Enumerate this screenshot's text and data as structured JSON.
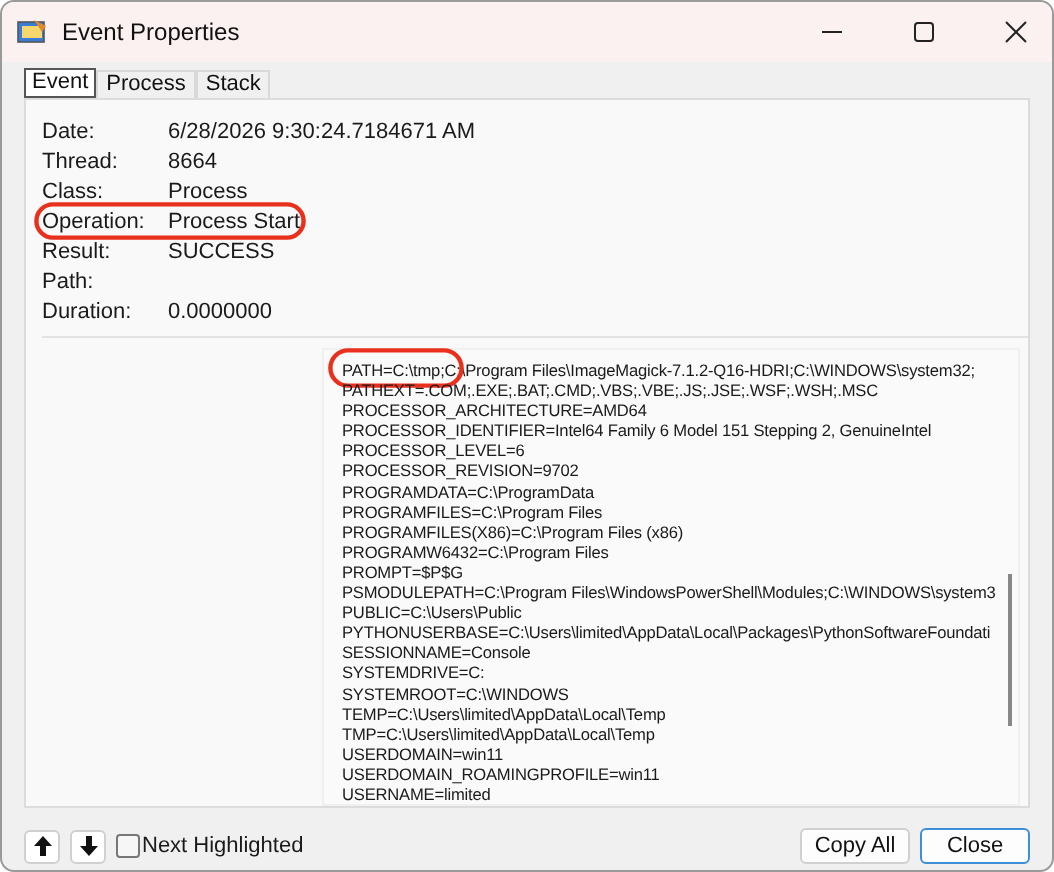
{
  "window": {
    "title": "Event Properties"
  },
  "tabs": [
    {
      "label": "Event",
      "selected": true
    },
    {
      "label": "Process",
      "selected": false
    },
    {
      "label": "Stack",
      "selected": false
    }
  ],
  "fields": [
    {
      "label": "Date:",
      "value": "6/28/2026 9:30:24.7184671 AM",
      "highlighted": false
    },
    {
      "label": "Thread:",
      "value": "8664",
      "highlighted": false
    },
    {
      "label": "Class:",
      "value": "Process",
      "highlighted": false
    },
    {
      "label": "Operation:",
      "value": "Process Start",
      "highlighted": true
    },
    {
      "label": "Result:",
      "value": "SUCCESS",
      "highlighted": false
    },
    {
      "label": "Path:",
      "highlighted": false
    },
    {
      "label": "Duration:",
      "value": "0.0000000",
      "highlighted": false
    }
  ],
  "details": {
    "lines": [
      {
        "text": "PATH=C:\\tmp;C:\\Program Files\\ImageMagick-7.1.2-Q16-HDRI;C:\\WINDOWS\\system32;",
        "highlighted": true
      },
      {
        "text": "PATHEXT=.COM;.EXE;.BAT;.CMD;.VBS;.VBE;.JS;.JSE;.WSF;.WSH;.MSC",
        "highlighted": false
      },
      {
        "text": "PROCESSOR_ARCHITECTURE=AMD64",
        "highlighted": false
      },
      {
        "text": "PROCESSOR_IDENTIFIER=Intel64 Family 6 Model 151 Stepping 2, GenuineIntel",
        "highlighted": false
      },
      {
        "text": "PROCESSOR_LEVEL=6",
        "highlighted": false
      },
      {
        "text": "PROCESSOR_REVISION=9702",
        "highlighted": false
      },
      {
        "text": "PROGRAMDATA=C:\\ProgramData",
        "highlighted": false
      },
      {
        "text": "PROGRAMFILES=C:\\Program Files",
        "highlighted": false
      },
      {
        "text": "PROGRAMFILES(X86)=C:\\Program Files (x86)",
        "highlighted": false
      },
      {
        "text": "PROGRAMW6432=C:\\Program Files",
        "highlighted": false
      },
      {
        "text": "PROMPT=$P$G",
        "highlighted": false
      },
      {
        "text": "PSMODULEPATH=C:\\Program Files\\WindowsPowerShell\\Modules;C:\\WINDOWS\\system3",
        "highlighted": false
      },
      {
        "text": "PUBLIC=C:\\Users\\Public",
        "highlighted": false
      },
      {
        "text": "PYTHONUSERBASE=C:\\Users\\limited\\AppData\\Local\\Packages\\PythonSoftwareFoundati",
        "highlighted": false
      },
      {
        "text": "SESSIONNAME=Console",
        "highlighted": false
      },
      {
        "text": "SYSTEMDRIVE=C:",
        "highlighted": false
      },
      {
        "text": "SYSTEMROOT=C:\\WINDOWS",
        "highlighted": false
      },
      {
        "text": "TEMP=C:\\Users\\limited\\AppData\\Local\\Temp",
        "highlighted": false
      },
      {
        "text": "TMP=C:\\Users\\limited\\AppData\\Local\\Temp",
        "highlighted": false
      },
      {
        "text": "USERDOMAIN=win11",
        "highlighted": false
      },
      {
        "text": "USERDOMAIN_ROAMINGPROFILE=win11",
        "highlighted": false
      },
      {
        "text": "USERNAME=limited",
        "highlighted": false
      }
    ]
  },
  "footer": {
    "next_highlighted": {
      "label": "Next Highlighted",
      "checked": false
    },
    "buttons": [
      {
        "label": "Copy All",
        "default": false
      },
      {
        "label": "Close",
        "default": true
      }
    ]
  }
}
